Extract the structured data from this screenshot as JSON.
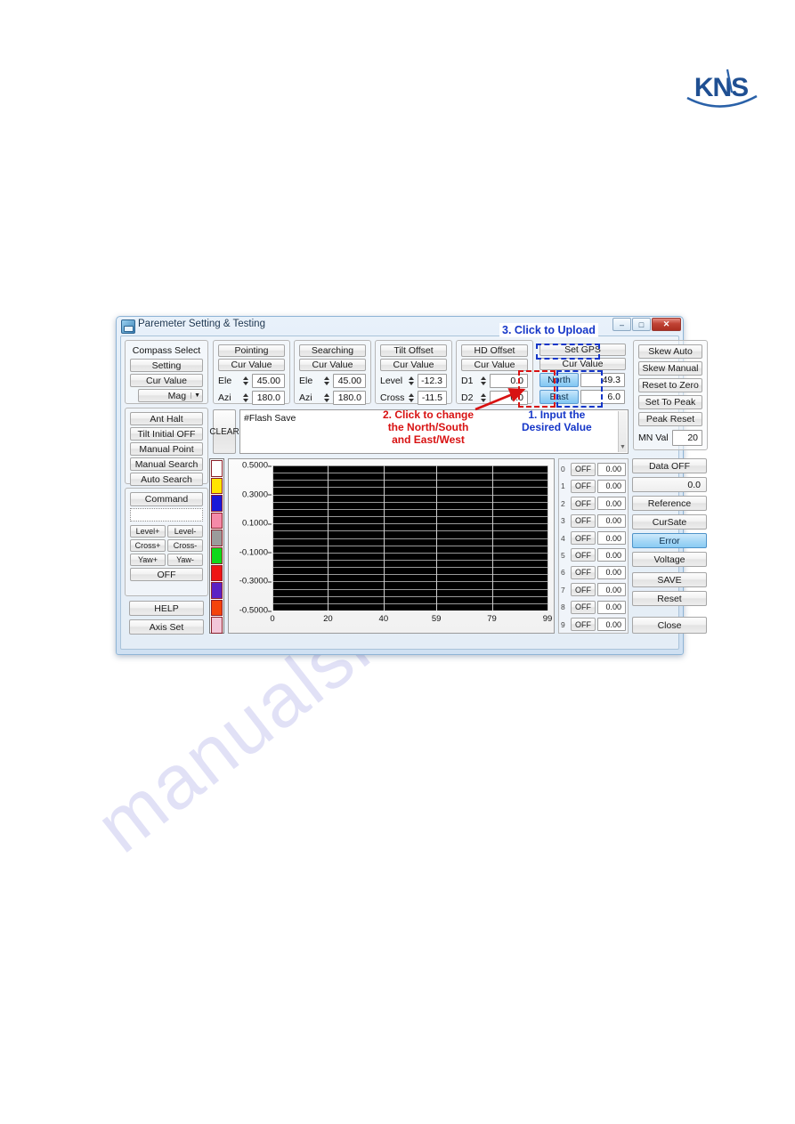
{
  "brand": {
    "logo_text": "KNS"
  },
  "watermark": {
    "text": "manualslib.com"
  },
  "window": {
    "title": "Paremeter Setting & Testing",
    "icon": "app-icon",
    "controls": {
      "minimize": "–",
      "maximize": "□",
      "close": "✕"
    }
  },
  "compass": {
    "title": "Compass Select",
    "setting": "Setting",
    "cur_value": "Cur Value",
    "select_value": "Mag",
    "dropdown_icon": "chevron-down-icon"
  },
  "ant": {
    "ant_halt": "Ant Halt",
    "tilt_initial": "Tilt Initial OFF",
    "manual_point": "Manual Point",
    "manual_search": "Manual Search",
    "auto_search": "Auto Search"
  },
  "command": {
    "title": "Command",
    "input_value": "",
    "level_plus": "Level+",
    "level_minus": "Level-",
    "cross_plus": "Cross+",
    "cross_minus": "Cross-",
    "yaw_plus": "Yaw+",
    "yaw_minus": "Yaw-",
    "off": "OFF",
    "help": "HELP",
    "axis_set": "Axis Set"
  },
  "pointing": {
    "title": "Pointing",
    "cur_value": "Cur Value",
    "ele_label": "Ele",
    "ele_value": "45.00",
    "azi_label": "Azi",
    "azi_value": "180.0"
  },
  "searching": {
    "title": "Searching",
    "cur_value": "Cur Value",
    "ele_label": "Ele",
    "ele_value": "45.00",
    "azi_label": "Azi",
    "azi_value": "180.0"
  },
  "tilt_offset": {
    "title": "Tilt Offset",
    "cur_value": "Cur Value",
    "level_label": "Level",
    "level_value": "-12.3",
    "cross_label": "Cross",
    "cross_value": "-11.5"
  },
  "hd_offset": {
    "title": "HD Offset",
    "cur_value": "Cur Value",
    "d1_label": "D1",
    "d1_value": "0.0",
    "d2_label": "D2",
    "d2_value": "0.0"
  },
  "gps": {
    "set_gps": "Set GPS",
    "cur_value": "Cur Value",
    "lat_dir": "North",
    "lat_value": "49.3",
    "lon_dir": "East",
    "lon_value": "6.0"
  },
  "skew": {
    "skew_auto": "Skew Auto",
    "skew_manual": "Skew Manual",
    "reset_to_zero": "Reset to Zero",
    "set_to_peak": "Set To Peak",
    "peak_reset": "Peak Reset",
    "mn_val_label": "MN Val",
    "mn_val_value": "20"
  },
  "console": {
    "clear_label": "CLEAR",
    "log_text": "#Flash Save",
    "scroll_icon": "scroll-down-icon"
  },
  "legend_colors": [
    "#ffffff",
    "#ffe400",
    "#1a18d8",
    "#f58aa8",
    "#9b9b9b",
    "#10d81a",
    "#ee1414",
    "#5b22c4",
    "#f4430c",
    "#f2c6d8"
  ],
  "data_rows": [
    {
      "index": "0",
      "state": "OFF",
      "value": "0.00"
    },
    {
      "index": "1",
      "state": "OFF",
      "value": "0.00"
    },
    {
      "index": "2",
      "state": "OFF",
      "value": "0.00"
    },
    {
      "index": "3",
      "state": "OFF",
      "value": "0.00"
    },
    {
      "index": "4",
      "state": "OFF",
      "value": "0.00"
    },
    {
      "index": "5",
      "state": "OFF",
      "value": "0.00"
    },
    {
      "index": "6",
      "state": "OFF",
      "value": "0.00"
    },
    {
      "index": "7",
      "state": "OFF",
      "value": "0.00"
    },
    {
      "index": "8",
      "state": "OFF",
      "value": "0.00"
    },
    {
      "index": "9",
      "state": "OFF",
      "value": "0.00"
    }
  ],
  "right_panel": {
    "data_off": "Data OFF",
    "data_value": "0.0",
    "reference": "Reference",
    "cursate": "CurSate",
    "error": "Error",
    "voltage": "Voltage",
    "save": "SAVE",
    "reset": "Reset",
    "close": "Close",
    "selected": "Error"
  },
  "annotations": [
    {
      "id": "upload",
      "text": "3. Click to Upload",
      "color": "#1536c8"
    },
    {
      "id": "input",
      "line1": "1. Input the",
      "line2": "Desired Value",
      "color": "#1536c8"
    },
    {
      "id": "change",
      "line1": "2. Click to change",
      "line2": "the North/South",
      "line3": "and East/West",
      "color": "#d81212"
    }
  ],
  "chart_data": {
    "type": "line",
    "title": "",
    "xlabel": "",
    "ylabel": "",
    "series": [],
    "x": [],
    "xticks": [
      "0",
      "20",
      "40",
      "59",
      "79",
      "99"
    ],
    "xtick_values": [
      0,
      20,
      40,
      59,
      79,
      99
    ],
    "yticks": [
      "0.5000",
      "0.3000",
      "0.1000",
      "-0.1000",
      "-0.3000",
      "-0.5000"
    ],
    "ytick_values": [
      0.5,
      0.3,
      0.1,
      -0.1,
      -0.3,
      -0.5
    ],
    "xlim": [
      0,
      99
    ],
    "ylim": [
      -0.5,
      0.5
    ],
    "grid": true,
    "plot_background": "#000000",
    "gridline_color": "#9a9a9a",
    "legend_position": "left"
  }
}
